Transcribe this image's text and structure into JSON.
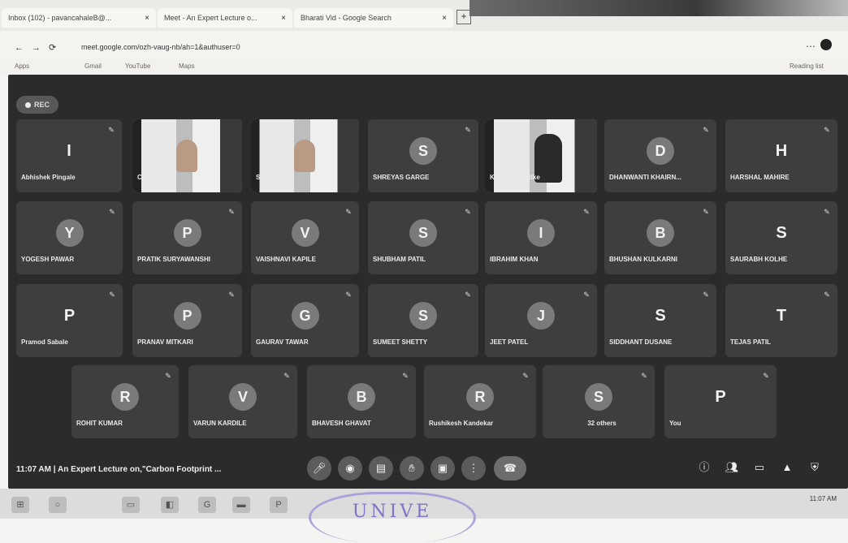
{
  "browser": {
    "tabs": [
      {
        "label": "Inbox (102) - pavancahaleB@..."
      },
      {
        "label": "Meet - An Expert Lecture o..."
      },
      {
        "label": "Bharati Vid - Google Search"
      }
    ],
    "new_tab_label": "+",
    "url": "meet.google.com/ozh-vaug-nb/ah=1&authuser=0",
    "bookmarks": [
      "Apps",
      "Gmail",
      "YouTube",
      "Maps"
    ],
    "reading_list": "Reading list"
  },
  "meeting": {
    "rec_label": "REC",
    "title": "11:07 AM  |  An Expert Lecture on,\"Carbon Footprint ...",
    "participants": [
      {
        "name": "Abhishek Pingale",
        "initial": "I",
        "video": false,
        "plain": true
      },
      {
        "name": "Civil",
        "initial": "",
        "video": true
      },
      {
        "name": "Swati",
        "initial": "",
        "video": true
      },
      {
        "name": "SHREYAS GARGE",
        "initial": "S",
        "video": false
      },
      {
        "name": "Kaushik Phadke",
        "initial": "",
        "video": true
      },
      {
        "name": "DHANWANTI KHAIRN...",
        "initial": "D",
        "video": false
      },
      {
        "name": "HARSHAL MAHIRE",
        "initial": "H",
        "video": false,
        "plain": true
      },
      {
        "name": "YOGESH PAWAR",
        "initial": "Y",
        "video": false
      },
      {
        "name": "PRATIK SURYAWANSHI",
        "initial": "P",
        "video": false
      },
      {
        "name": "VAISHNAVI KAPILE",
        "initial": "V",
        "video": false
      },
      {
        "name": "SHUBHAM PATIL",
        "initial": "S",
        "video": false
      },
      {
        "name": "IBRAHIM KHAN",
        "initial": "I",
        "video": false
      },
      {
        "name": "BHUSHAN KULKARNI",
        "initial": "B",
        "video": false
      },
      {
        "name": "SAURABH KOLHE",
        "initial": "S",
        "video": false,
        "plain": true
      },
      {
        "name": "Pramod Sabale",
        "initial": "P",
        "video": false,
        "plain": true
      },
      {
        "name": "PRANAV MITKARI",
        "initial": "P",
        "video": false
      },
      {
        "name": "GAURAV TAWAR",
        "initial": "G",
        "video": false
      },
      {
        "name": "SUMEET SHETTY",
        "initial": "S",
        "video": false
      },
      {
        "name": "JEET PATEL",
        "initial": "J",
        "video": false
      },
      {
        "name": "SIDDHANT DUSANE",
        "initial": "S",
        "video": false,
        "plain": true
      },
      {
        "name": "TEJAS PATIL",
        "initial": "T",
        "video": false,
        "plain": true
      },
      {
        "name": "ROHIT KUMAR",
        "initial": "R",
        "video": false
      },
      {
        "name": "VARUN KARDILE",
        "initial": "V",
        "video": false
      },
      {
        "name": "BHAVESH GHAVAT",
        "initial": "B",
        "video": false
      },
      {
        "name": "Rushikesh Kandekar",
        "initial": "R",
        "video": false
      },
      {
        "name": "32 others",
        "initial": "S",
        "video": false,
        "others": true
      },
      {
        "name": "You",
        "initial": "P",
        "video": false,
        "plain": true
      }
    ],
    "controls": [
      "mic-off-icon",
      "camera-off-icon",
      "captions-icon",
      "raise-hand-icon",
      "present-icon",
      "more-options-icon",
      "leave-call-icon"
    ],
    "right_controls": [
      "info-icon",
      "people-icon",
      "chat-icon",
      "activities-icon",
      "host-controls-icon"
    ]
  },
  "taskbar": {
    "clock": "11:07 AM"
  },
  "stamp": {
    "text": "UNIVE"
  }
}
